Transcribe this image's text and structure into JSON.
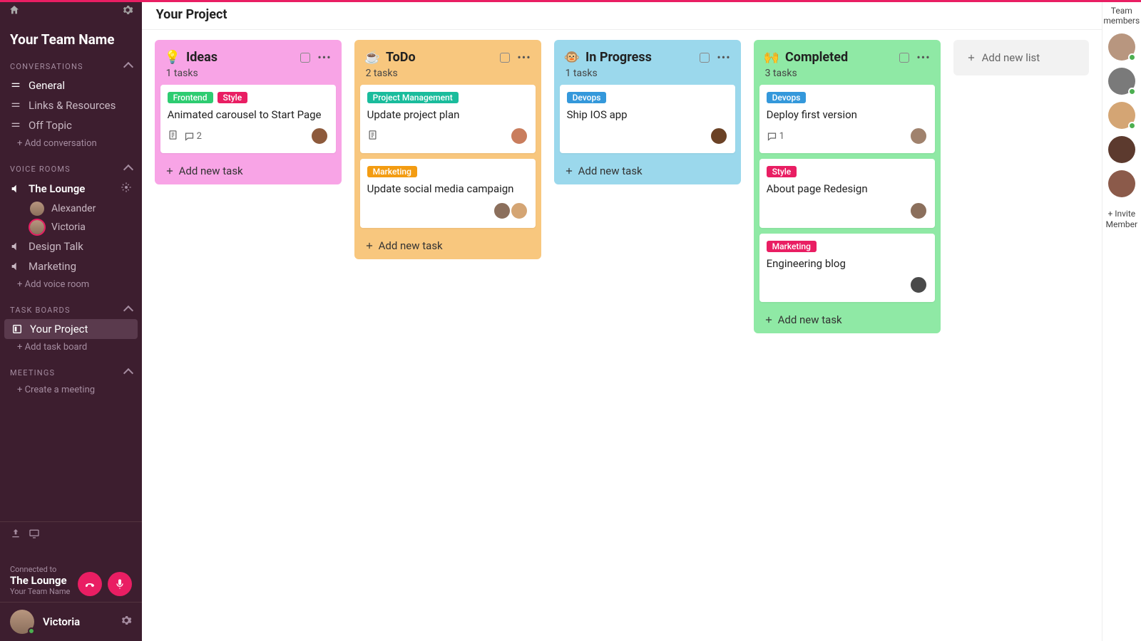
{
  "sidebar": {
    "team_name": "Your Team Name",
    "sections": {
      "conversations": {
        "label": "CONVERSATIONS",
        "items": [
          "General",
          "Links & Resources",
          "Off Topic"
        ],
        "add": "+ Add conversation"
      },
      "voice": {
        "label": "VOICE ROOMS",
        "rooms": [
          {
            "name": "The Lounge",
            "users": [
              "Alexander",
              "Victoria"
            ]
          },
          {
            "name": "Design Talk",
            "users": []
          },
          {
            "name": "Marketing",
            "users": []
          }
        ],
        "add": "+ Add voice room"
      },
      "boards": {
        "label": "TASK BOARDS",
        "items": [
          "Your Project"
        ],
        "add": "+ Add task board"
      },
      "meetings": {
        "label": "MEETINGS",
        "add": "+ Create a meeting"
      }
    },
    "voice_status": {
      "connected_label": "Connected to",
      "room": "The Lounge",
      "team": "Your Team Name"
    },
    "current_user": "Victoria"
  },
  "header": {
    "title": "Your Project"
  },
  "board": {
    "lists": [
      {
        "emoji": "💡",
        "title": "Ideas",
        "color": "#f8a4e6",
        "count": "1 tasks",
        "cards": [
          {
            "tags": [
              {
                "text": "Frontend",
                "color": "#2ecc71"
              },
              {
                "text": "Style",
                "color": "#e91e63"
              }
            ],
            "title": "Animated carousel to Start Page",
            "desc": true,
            "comments": "2",
            "avatars": 1,
            "avatar_colors": [
              "#8d5a3c"
            ]
          }
        ]
      },
      {
        "emoji": "☕",
        "title": "ToDo",
        "color": "#f8c77e",
        "count": "2 tasks",
        "cards": [
          {
            "tags": [
              {
                "text": "Project Management",
                "color": "#1abc9c"
              }
            ],
            "title": "Update project plan",
            "desc": true,
            "comments": null,
            "avatars": 1,
            "avatar_colors": [
              "#c97d5d"
            ]
          },
          {
            "tags": [
              {
                "text": "Marketing",
                "color": "#f39c12"
              }
            ],
            "title": "Update social media campaign",
            "desc": false,
            "comments": null,
            "avatars": 2,
            "avatar_colors": [
              "#8b6f5c",
              "#d4a574"
            ]
          }
        ]
      },
      {
        "emoji": "🐵",
        "title": "In Progress",
        "color": "#9bd8ec",
        "count": "1 tasks",
        "cards": [
          {
            "tags": [
              {
                "text": "Devops",
                "color": "#3498db"
              }
            ],
            "title": "Ship IOS app",
            "desc": false,
            "comments": null,
            "avatars": 1,
            "avatar_colors": [
              "#6b4226"
            ]
          }
        ]
      },
      {
        "emoji": "🙌",
        "title": "Completed",
        "color": "#8fe9a5",
        "count": "3 tasks",
        "cards": [
          {
            "tags": [
              {
                "text": "Devops",
                "color": "#3498db"
              }
            ],
            "title": "Deploy first version",
            "desc": false,
            "comments": "1",
            "avatars": 1,
            "avatar_colors": [
              "#a0826d"
            ]
          },
          {
            "tags": [
              {
                "text": "Style",
                "color": "#e91e63"
              }
            ],
            "title": "About page Redesign",
            "desc": false,
            "comments": null,
            "avatars": 1,
            "avatar_colors": [
              "#8b6f5c"
            ]
          },
          {
            "tags": [
              {
                "text": "Marketing",
                "color": "#e91e63"
              }
            ],
            "title": "Engineering blog",
            "desc": false,
            "comments": null,
            "avatars": 1,
            "avatar_colors": [
              "#4a4a4a"
            ]
          }
        ]
      }
    ],
    "add_task": "Add new task",
    "add_list": "Add new list"
  },
  "members": {
    "title": "Team members",
    "count": 5,
    "avatar_colors": [
      "#b8967f",
      "#7a7a7a",
      "#d4a574",
      "#5c3a2e",
      "#8b5a4a"
    ],
    "online": [
      true,
      true,
      true,
      false,
      false
    ],
    "invite": "+ Invite Member"
  }
}
